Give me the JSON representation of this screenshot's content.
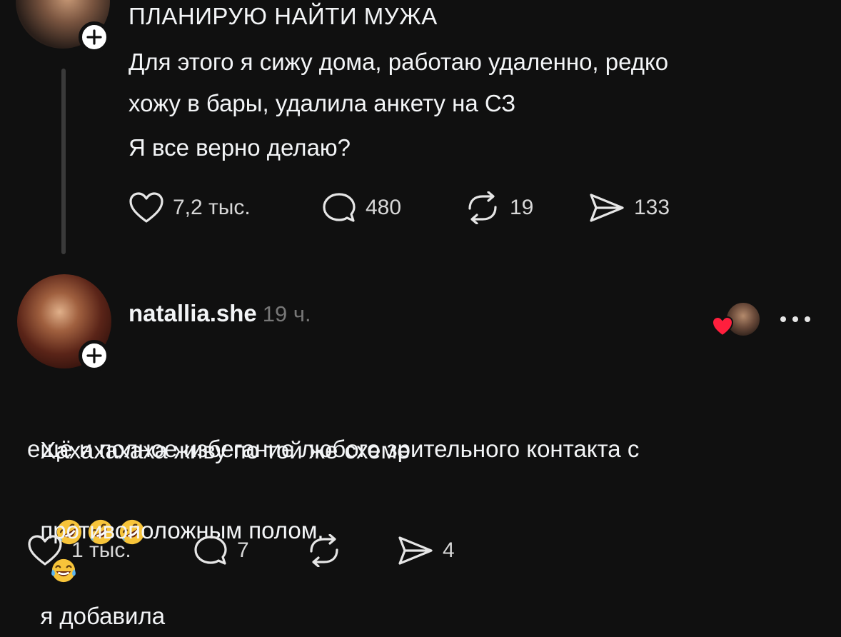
{
  "post": {
    "title": "ПЛАНИРУЮ НАЙТИ МУЖА",
    "lines": [
      "Для этого я сижу дома, работаю удаленно, редко",
      "хожу в бары, удалила анкету на СЗ",
      "Я все верно делаю?"
    ],
    "actions": {
      "likes": "7,2 тыс.",
      "comments": "480",
      "reposts": "19",
      "shares": "133"
    }
  },
  "reply": {
    "username": "natallia.she",
    "time": "19 ч.",
    "line1_a": "Хахахахаха живу по той же схеме",
    "line1_b": "я добавила",
    "line2": "ещё и полное избегание любого зрительного контакта с",
    "line3": "противоположным полом.",
    "emojis": [
      "rolling-on-floor-laughing",
      "rolling-on-floor-laughing",
      "rolling-on-floor-laughing",
      "face-with-tears-of-joy"
    ],
    "actions": {
      "likes": "1 тыс.",
      "comments": "7",
      "reposts": "",
      "shares": "4"
    }
  },
  "colors": {
    "background": "#101010",
    "text": "#f3f5f7",
    "muted": "#777777",
    "heart": "#ff1f3d"
  }
}
